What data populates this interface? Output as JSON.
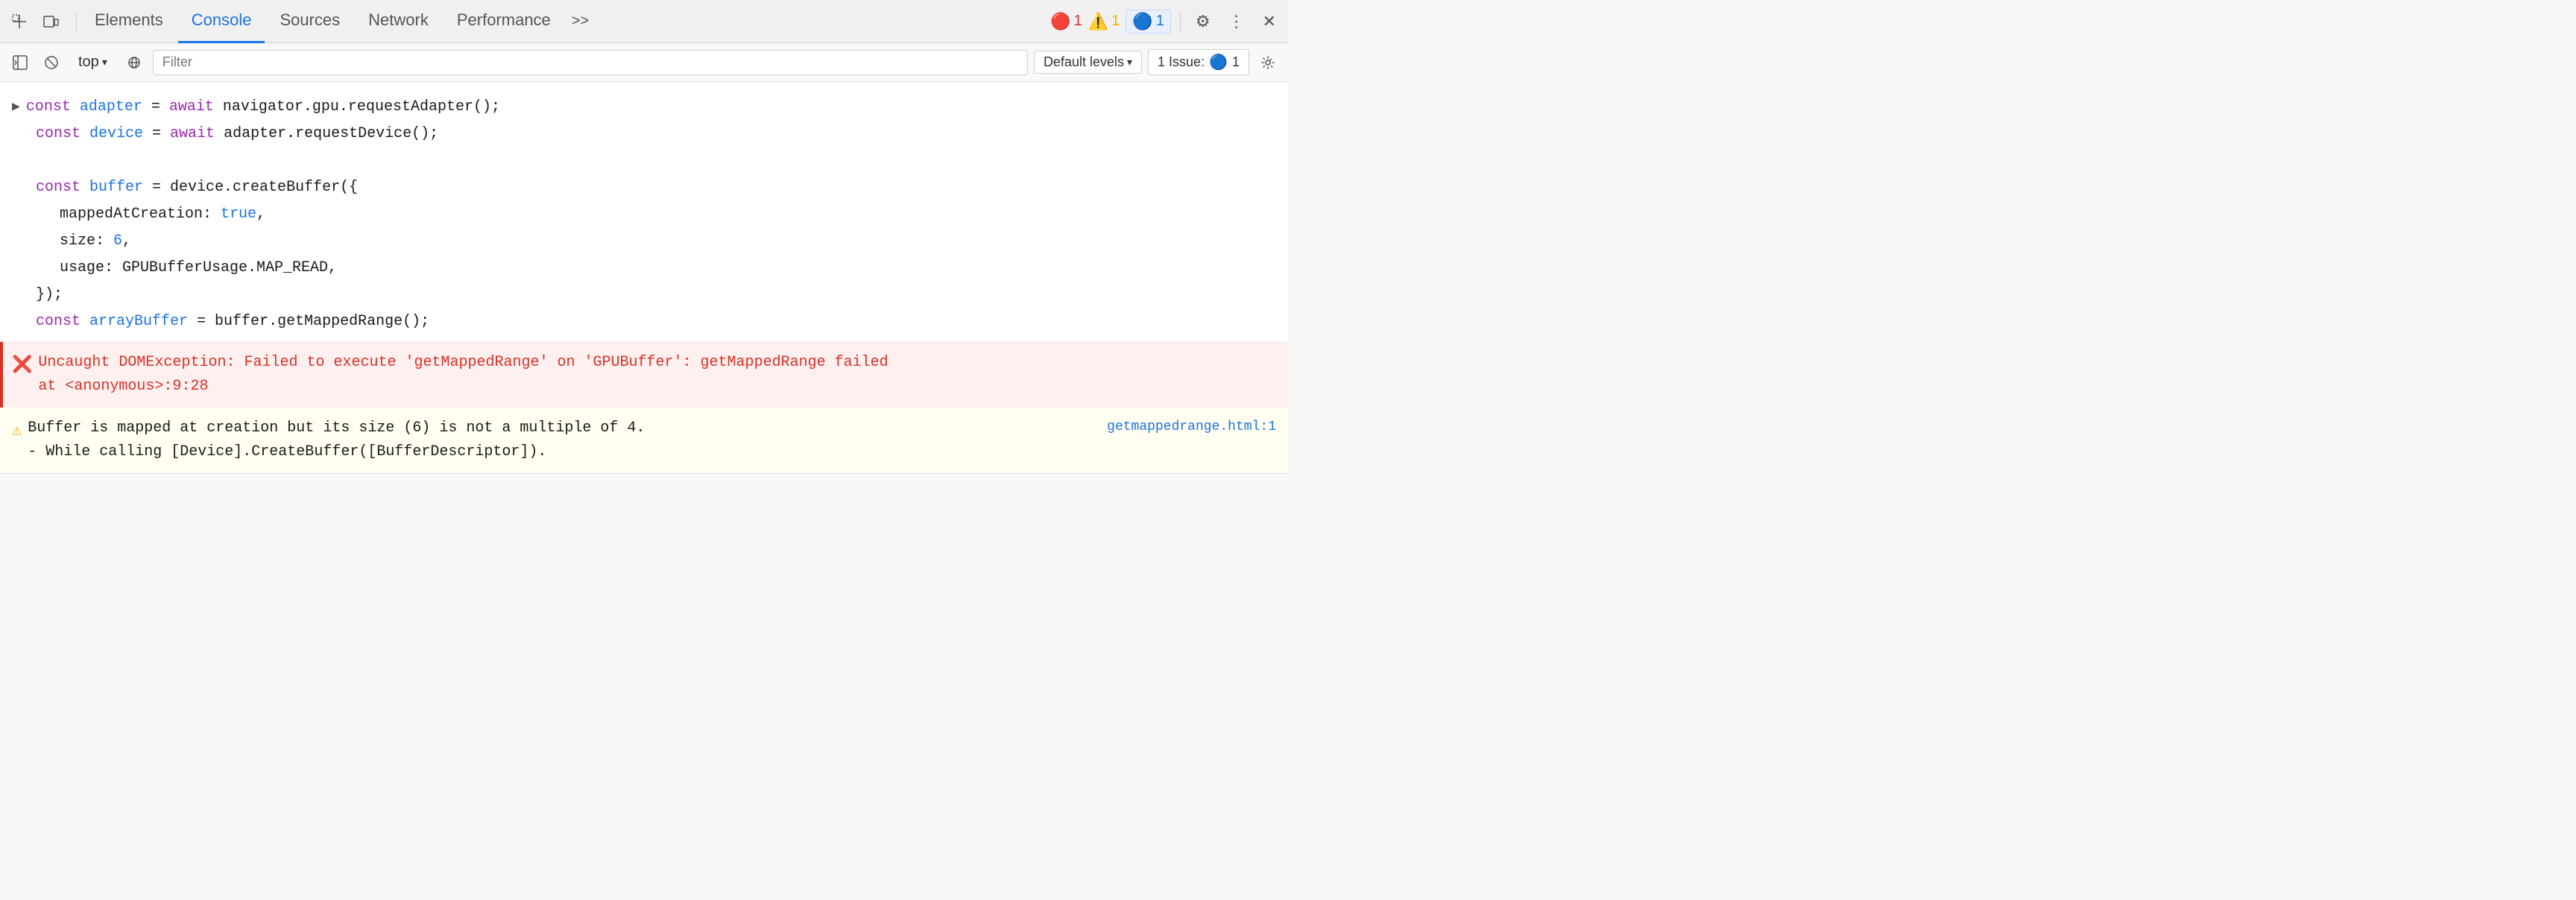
{
  "tabs": {
    "inspect_icon": "⬚",
    "device_icon": "⬜",
    "items": [
      {
        "label": "Elements",
        "active": false
      },
      {
        "label": "Console",
        "active": true
      },
      {
        "label": "Sources",
        "active": false
      },
      {
        "label": "Network",
        "active": false
      },
      {
        "label": "Performance",
        "active": false
      }
    ],
    "more": ">>",
    "badge_error_count": "1",
    "badge_warning_count": "1",
    "badge_info_count": "1",
    "settings_title": "Settings",
    "more_options": "More options",
    "close": "Close DevTools"
  },
  "toolbar": {
    "sidebar_icon": "▶",
    "clear_icon": "⊘",
    "top_label": "top",
    "dropdown_arrow": "▾",
    "eye_icon": "👁",
    "filter_placeholder": "Filter",
    "default_levels_label": "Default levels",
    "issues_label": "1 Issue:",
    "issues_count": "1",
    "gear_icon": "⚙"
  },
  "console": {
    "lines": [
      {
        "type": "code",
        "has_arrow": true,
        "parts": [
          {
            "text": "const ",
            "class": "kw-purple"
          },
          {
            "text": "adapter",
            "class": "kw-blue"
          },
          {
            "text": " = ",
            "class": "code-default"
          },
          {
            "text": "await ",
            "class": "kw-purple"
          },
          {
            "text": "navigator.gpu.requestAdapter();",
            "class": "code-default"
          }
        ]
      },
      {
        "type": "code",
        "has_arrow": false,
        "indent": true,
        "parts": [
          {
            "text": "const ",
            "class": "kw-purple"
          },
          {
            "text": "device",
            "class": "kw-blue"
          },
          {
            "text": " = ",
            "class": "code-default"
          },
          {
            "text": "await ",
            "class": "kw-purple"
          },
          {
            "text": "adapter.requestDevice();",
            "class": "code-default"
          }
        ]
      },
      {
        "type": "blank"
      },
      {
        "type": "code",
        "has_arrow": false,
        "indent": true,
        "parts": [
          {
            "text": "const ",
            "class": "kw-purple"
          },
          {
            "text": "buffer",
            "class": "kw-blue"
          },
          {
            "text": " = ",
            "class": "code-default"
          },
          {
            "text": "device.createBuffer({",
            "class": "code-default"
          }
        ]
      },
      {
        "type": "code",
        "has_arrow": false,
        "indent2": true,
        "parts": [
          {
            "text": "mappedAtCreation: ",
            "class": "code-default"
          },
          {
            "text": "true",
            "class": "val-blue"
          },
          {
            "text": ",",
            "class": "code-default"
          }
        ]
      },
      {
        "type": "code",
        "has_arrow": false,
        "indent2": true,
        "parts": [
          {
            "text": "size: ",
            "class": "code-default"
          },
          {
            "text": "6",
            "class": "val-blue"
          },
          {
            "text": ",",
            "class": "code-default"
          }
        ]
      },
      {
        "type": "code",
        "has_arrow": false,
        "indent2": true,
        "parts": [
          {
            "text": "usage: ",
            "class": "code-default"
          },
          {
            "text": "GPUBufferUsage.MAP_READ",
            "class": "code-default"
          },
          {
            "text": ",",
            "class": "code-default"
          }
        ]
      },
      {
        "type": "code",
        "has_arrow": false,
        "indent": true,
        "parts": [
          {
            "text": "});",
            "class": "code-default"
          }
        ]
      },
      {
        "type": "code",
        "has_arrow": false,
        "indent": true,
        "parts": [
          {
            "text": "const ",
            "class": "kw-purple"
          },
          {
            "text": "arrayBuffer",
            "class": "kw-blue"
          },
          {
            "text": " = ",
            "class": "code-default"
          },
          {
            "text": "buffer.getMappedRange();",
            "class": "code-default"
          }
        ]
      }
    ],
    "error": {
      "icon": "✖",
      "line1": "Uncaught DOMException: Failed to execute 'getMappedRange' on 'GPUBuffer': getMappedRange failed",
      "line2": "    at <anonymous>:9:28"
    },
    "warning": {
      "icon": "⚠",
      "line1": "Buffer is mapped at creation but its size (6) is not a multiple of 4.",
      "line2": "  - While calling [Device].CreateBuffer([BufferDescriptor]).",
      "link_text": "getmappedrange.html:1"
    }
  }
}
